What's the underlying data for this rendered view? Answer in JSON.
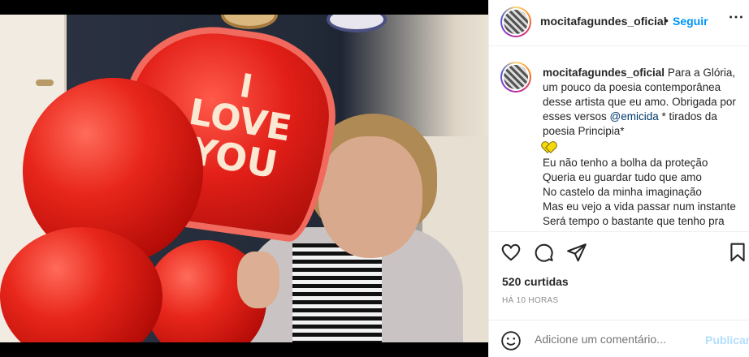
{
  "post": {
    "username": "mocitafagundes_oficial",
    "separator": "•",
    "follow_label": "Seguir",
    "more_icon": "more-options-icon"
  },
  "photo": {
    "balloon_text_line1": "I",
    "balloon_text_line2": "LOVE",
    "balloon_text_line3": "YOU"
  },
  "caption": {
    "username": "mocitafagundes_oficial",
    "intro": "Para a Glória, um pouco da poesia contemporânea desse artista que eu amo. Obrigada por esses versos",
    "mention": "@emicida",
    "intro_tail": " * tirados da poesia Principia*",
    "lines": [
      "Eu não tenho a bolha da proteção",
      "Queria eu guardar tudo que amo",
      "No castelo da minha imaginação",
      "Mas eu vejo a vida passar num instante",
      "Será tempo o bastante que tenho pra"
    ],
    "emoji_color": "#f5d90a"
  },
  "actions": {
    "like_icon": "heart-icon",
    "comment_icon": "comment-icon",
    "share_icon": "share-icon",
    "save_icon": "bookmark-icon"
  },
  "likes_text": "520 curtidas",
  "time_text": "HÁ 10 HORAS",
  "comment_box": {
    "placeholder": "Adicione um comentário...",
    "post_label": "Publicar"
  },
  "colors": {
    "link": "#0095f6",
    "mention": "#00376b",
    "post_disabled": "#b2dffc"
  }
}
